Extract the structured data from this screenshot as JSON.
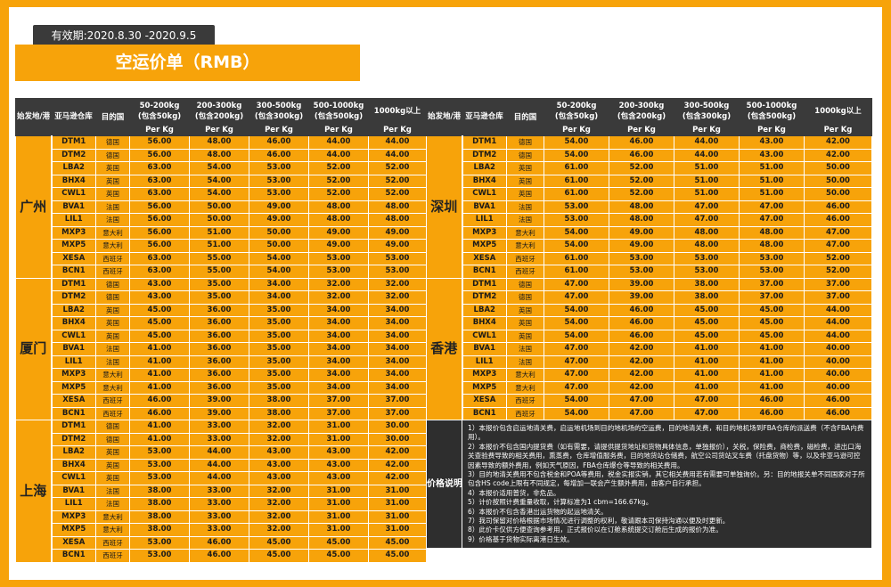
{
  "header": {
    "validity": "有效期:2020.8.30 -2020.9.5",
    "title": "空运价单（RMB）"
  },
  "columns": {
    "origin": "始发地/港",
    "warehouse": "亚马逊仓库",
    "destination": "目的国",
    "tiers": [
      {
        "range": "50-200kg",
        "incl": "(包含50kg)"
      },
      {
        "range": "200-300kg",
        "incl": "(包含200kg)"
      },
      {
        "range": "300-500kg",
        "incl": "(包含300kg)"
      },
      {
        "range": "500-1000kg",
        "incl": "(包含500kg)"
      },
      {
        "range": "1000kg以上",
        "incl": ""
      }
    ],
    "unit": "Per Kg"
  },
  "left_groups": [
    {
      "city": "广州",
      "rows": [
        [
          "DTM1",
          "德国",
          "56.00",
          "48.00",
          "46.00",
          "44.00",
          "44.00"
        ],
        [
          "DTM2",
          "德国",
          "56.00",
          "48.00",
          "46.00",
          "44.00",
          "44.00"
        ],
        [
          "LBA2",
          "英国",
          "63.00",
          "54.00",
          "53.00",
          "52.00",
          "52.00"
        ],
        [
          "BHX4",
          "英国",
          "63.00",
          "54.00",
          "53.00",
          "52.00",
          "52.00"
        ],
        [
          "CWL1",
          "英国",
          "63.00",
          "54.00",
          "53.00",
          "52.00",
          "52.00"
        ],
        [
          "BVA1",
          "法国",
          "56.00",
          "50.00",
          "49.00",
          "48.00",
          "48.00"
        ],
        [
          "LIL1",
          "法国",
          "56.00",
          "50.00",
          "49.00",
          "48.00",
          "48.00"
        ],
        [
          "MXP3",
          "意大利",
          "56.00",
          "51.00",
          "50.00",
          "49.00",
          "49.00"
        ],
        [
          "MXP5",
          "意大利",
          "56.00",
          "51.00",
          "50.00",
          "49.00",
          "49.00"
        ],
        [
          "XESA",
          "西班牙",
          "63.00",
          "55.00",
          "54.00",
          "53.00",
          "53.00"
        ],
        [
          "BCN1",
          "西班牙",
          "63.00",
          "55.00",
          "54.00",
          "53.00",
          "53.00"
        ]
      ]
    },
    {
      "city": "厦门",
      "rows": [
        [
          "DTM1",
          "德国",
          "43.00",
          "35.00",
          "34.00",
          "32.00",
          "32.00"
        ],
        [
          "DTM2",
          "德国",
          "43.00",
          "35.00",
          "34.00",
          "32.00",
          "32.00"
        ],
        [
          "LBA2",
          "英国",
          "45.00",
          "36.00",
          "35.00",
          "34.00",
          "34.00"
        ],
        [
          "BHX4",
          "英国",
          "45.00",
          "36.00",
          "35.00",
          "34.00",
          "34.00"
        ],
        [
          "CWL1",
          "英国",
          "45.00",
          "36.00",
          "35.00",
          "34.00",
          "34.00"
        ],
        [
          "BVA1",
          "法国",
          "41.00",
          "36.00",
          "35.00",
          "34.00",
          "34.00"
        ],
        [
          "LIL1",
          "法国",
          "41.00",
          "36.00",
          "35.00",
          "34.00",
          "34.00"
        ],
        [
          "MXP3",
          "意大利",
          "41.00",
          "36.00",
          "35.00",
          "34.00",
          "34.00"
        ],
        [
          "MXP5",
          "意大利",
          "41.00",
          "36.00",
          "35.00",
          "34.00",
          "34.00"
        ],
        [
          "XESA",
          "西班牙",
          "46.00",
          "39.00",
          "38.00",
          "37.00",
          "37.00"
        ],
        [
          "BCN1",
          "西班牙",
          "46.00",
          "39.00",
          "38.00",
          "37.00",
          "37.00"
        ]
      ]
    },
    {
      "city": "上海",
      "rows": [
        [
          "DTM1",
          "德国",
          "41.00",
          "33.00",
          "32.00",
          "31.00",
          "30.00"
        ],
        [
          "DTM2",
          "德国",
          "41.00",
          "33.00",
          "32.00",
          "31.00",
          "30.00"
        ],
        [
          "LBA2",
          "英国",
          "53.00",
          "44.00",
          "43.00",
          "43.00",
          "42.00"
        ],
        [
          "BHX4",
          "英国",
          "53.00",
          "44.00",
          "43.00",
          "43.00",
          "42.00"
        ],
        [
          "CWL1",
          "英国",
          "53.00",
          "44.00",
          "43.00",
          "43.00",
          "42.00"
        ],
        [
          "BVA1",
          "法国",
          "38.00",
          "33.00",
          "32.00",
          "31.00",
          "31.00"
        ],
        [
          "LIL1",
          "法国",
          "38.00",
          "33.00",
          "32.00",
          "31.00",
          "31.00"
        ],
        [
          "MXP3",
          "意大利",
          "38.00",
          "33.00",
          "32.00",
          "31.00",
          "31.00"
        ],
        [
          "MXP5",
          "意大利",
          "38.00",
          "33.00",
          "32.00",
          "31.00",
          "31.00"
        ],
        [
          "XESA",
          "西班牙",
          "53.00",
          "46.00",
          "45.00",
          "45.00",
          "45.00"
        ],
        [
          "BCN1",
          "西班牙",
          "53.00",
          "46.00",
          "45.00",
          "45.00",
          "45.00"
        ]
      ]
    }
  ],
  "right_groups": [
    {
      "city": "深圳",
      "rows": [
        [
          "DTM1",
          "德国",
          "54.00",
          "46.00",
          "44.00",
          "43.00",
          "42.00"
        ],
        [
          "DTM2",
          "德国",
          "54.00",
          "46.00",
          "44.00",
          "43.00",
          "42.00"
        ],
        [
          "LBA2",
          "英国",
          "61.00",
          "52.00",
          "51.00",
          "51.00",
          "50.00"
        ],
        [
          "BHX4",
          "英国",
          "61.00",
          "52.00",
          "51.00",
          "51.00",
          "50.00"
        ],
        [
          "CWL1",
          "英国",
          "61.00",
          "52.00",
          "51.00",
          "51.00",
          "50.00"
        ],
        [
          "BVA1",
          "法国",
          "53.00",
          "48.00",
          "47.00",
          "47.00",
          "46.00"
        ],
        [
          "LIL1",
          "法国",
          "53.00",
          "48.00",
          "47.00",
          "47.00",
          "46.00"
        ],
        [
          "MXP3",
          "意大利",
          "54.00",
          "49.00",
          "48.00",
          "48.00",
          "47.00"
        ],
        [
          "MXP5",
          "意大利",
          "54.00",
          "49.00",
          "48.00",
          "48.00",
          "47.00"
        ],
        [
          "XESA",
          "西班牙",
          "61.00",
          "53.00",
          "53.00",
          "53.00",
          "52.00"
        ],
        [
          "BCN1",
          "西班牙",
          "61.00",
          "53.00",
          "53.00",
          "53.00",
          "52.00"
        ]
      ]
    },
    {
      "city": "香港",
      "rows": [
        [
          "DTM1",
          "德国",
          "47.00",
          "39.00",
          "38.00",
          "37.00",
          "37.00"
        ],
        [
          "DTM2",
          "德国",
          "47.00",
          "39.00",
          "38.00",
          "37.00",
          "37.00"
        ],
        [
          "LBA2",
          "英国",
          "54.00",
          "46.00",
          "45.00",
          "45.00",
          "44.00"
        ],
        [
          "BHX4",
          "英国",
          "54.00",
          "46.00",
          "45.00",
          "45.00",
          "44.00"
        ],
        [
          "CWL1",
          "英国",
          "54.00",
          "46.00",
          "45.00",
          "45.00",
          "44.00"
        ],
        [
          "BVA1",
          "法国",
          "47.00",
          "42.00",
          "41.00",
          "41.00",
          "40.00"
        ],
        [
          "LIL1",
          "法国",
          "47.00",
          "42.00",
          "41.00",
          "41.00",
          "40.00"
        ],
        [
          "MXP3",
          "意大利",
          "47.00",
          "42.00",
          "41.00",
          "41.00",
          "40.00"
        ],
        [
          "MXP5",
          "意大利",
          "47.00",
          "42.00",
          "41.00",
          "41.00",
          "40.00"
        ],
        [
          "XESA",
          "西班牙",
          "54.00",
          "47.00",
          "47.00",
          "46.00",
          "46.00"
        ],
        [
          "BCN1",
          "西班牙",
          "54.00",
          "47.00",
          "47.00",
          "46.00",
          "46.00"
        ]
      ]
    }
  ],
  "notes_label": "价格说明",
  "notes": [
    "1）本报价包含启运地清关费，启运地机场到目的地机场的空运费，目的地清关费，和目的地机场到FBA仓库的派送费（不含FBA内费用）。",
    "2）本报价不包含国内提货费（如有需要，请提供提货地址和货物具体信息，单独报价），关税，保险费，商检费，磁检费，进出口海关查验费导致的相关费用，熏蒸费，仓库增值服务费，目的地货站仓储费，航空公司货站叉车费（托盘货物）等，以及非亚马逊可控因素导致的额外费用，例如天气原因，FBA仓库爆仓等导致的相关费用。",
    "3）目的地清关费用不包含税金和POA等费用，税金实报实销，其它相关费用若有需要可单独询价。另：目的地报关单不同国家对于所包含HS code上限有不同规定，每增加一联会产生额外费用，由客户自行承担。",
    "4）本报价适用普货，非危品。",
    "5）计价按照计费重量收取，计算标准为1 cbm=166.67kg。",
    "6）本报价不包含香港出运货物的起运地清关。",
    "7）我司保留对价格根据市场情况进行调整的权利，敬请跟本司保持沟通以便及时更新。",
    "8）此价卡仅供方便查询参考用，正式报价以在订舱系统提交订舱后生成的报价为准。",
    "9）价格基于货物实际离港日生效。"
  ]
}
